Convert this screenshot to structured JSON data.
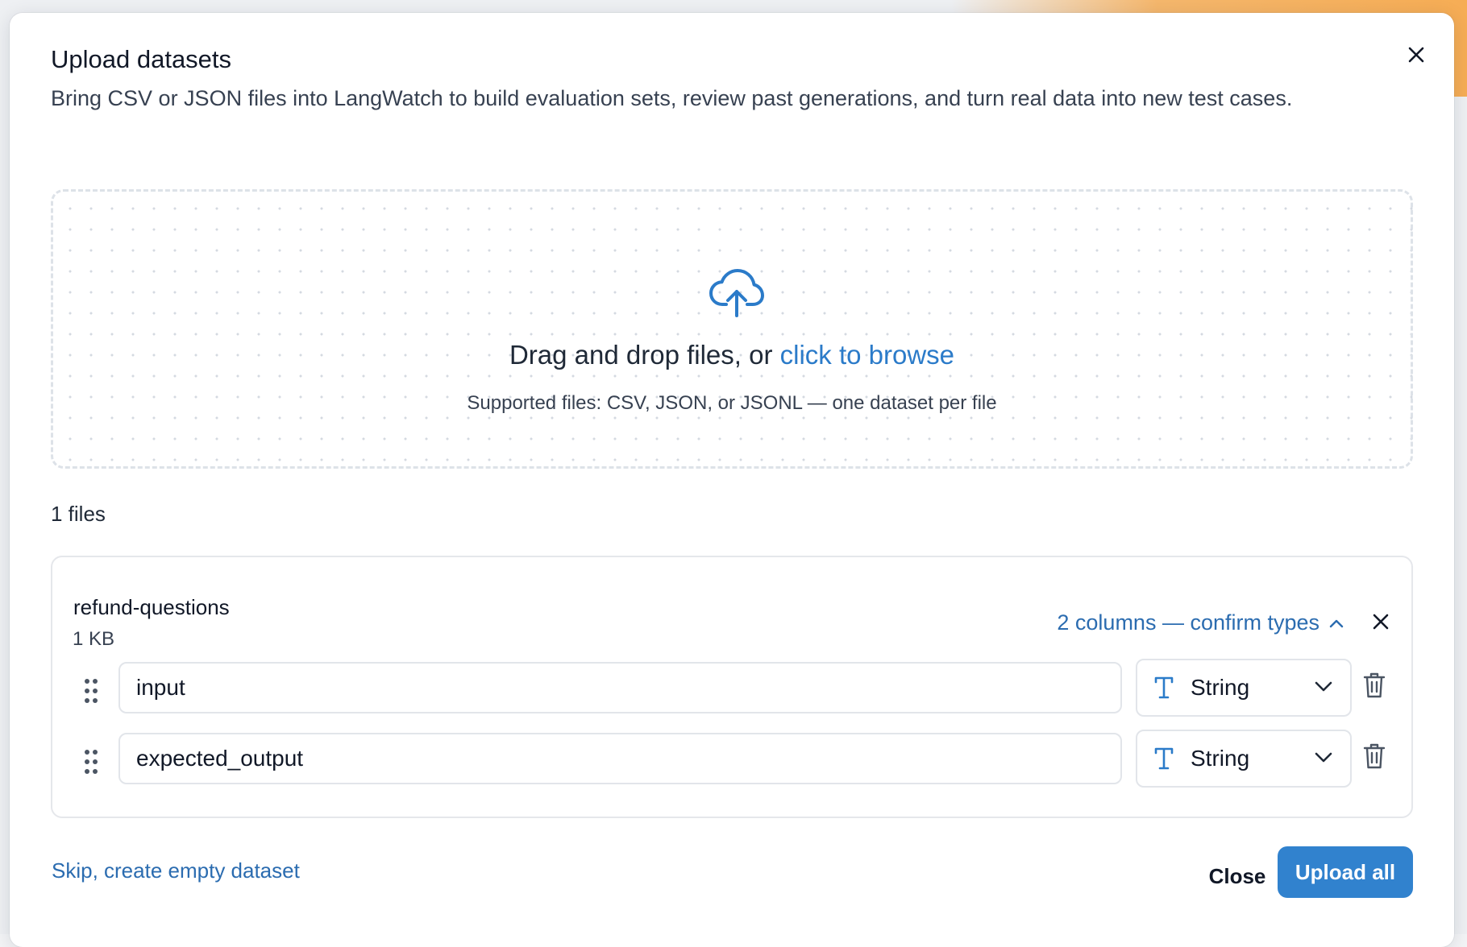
{
  "dialog": {
    "title": "Upload datasets",
    "description": "Bring CSV or JSON files into LangWatch to build evaluation sets, review past generations, and turn real data into new test cases.",
    "close_icon": "close-icon"
  },
  "dropzone": {
    "icon": "cloud-upload-icon",
    "main_text": "Drag and drop files, or ",
    "browse_link": "click to browse",
    "supported_text": "Supported files: CSV, JSON, or JSONL — one dataset per file",
    "accent_color": "#2b7bc9"
  },
  "files": {
    "count_label": "1 files",
    "items": [
      {
        "name": "refund-questions",
        "size": "1 KB",
        "columns_toggle": "2 columns — confirm types",
        "columns": [
          {
            "name": "input",
            "type": "String"
          },
          {
            "name": "expected_output",
            "type": "String"
          }
        ]
      }
    ]
  },
  "footer": {
    "skip_link": "Skip, create empty dataset",
    "close_label": "Close",
    "upload_label": "Upload all",
    "primary_color": "#3182ce",
    "link_color": "#2b6cb0"
  }
}
